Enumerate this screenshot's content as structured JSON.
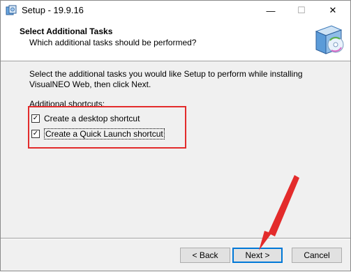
{
  "window": {
    "title": "Setup - 19.9.16"
  },
  "titlebar_buttons": {
    "minimize": "—",
    "maximize": "☐",
    "close": "✕"
  },
  "header": {
    "title": "Select Additional Tasks",
    "subtitle": "Which additional tasks should be performed?"
  },
  "body": {
    "description": "Select the additional tasks you would like Setup to perform while installing VisualNEO Web, then click Next.",
    "section_label": "Additional shortcuts:",
    "checkboxes": [
      {
        "label": "Create a desktop shortcut",
        "checked": true
      },
      {
        "label": "Create a Quick Launch shortcut",
        "checked": true
      }
    ]
  },
  "buttons": {
    "back": "< Back",
    "next": "Next >",
    "cancel": "Cancel"
  },
  "colors": {
    "highlight": "#e32b2b",
    "accent": "#0078d7"
  },
  "icons": {
    "app": "setup-icon",
    "header": "installer-box-icon"
  }
}
